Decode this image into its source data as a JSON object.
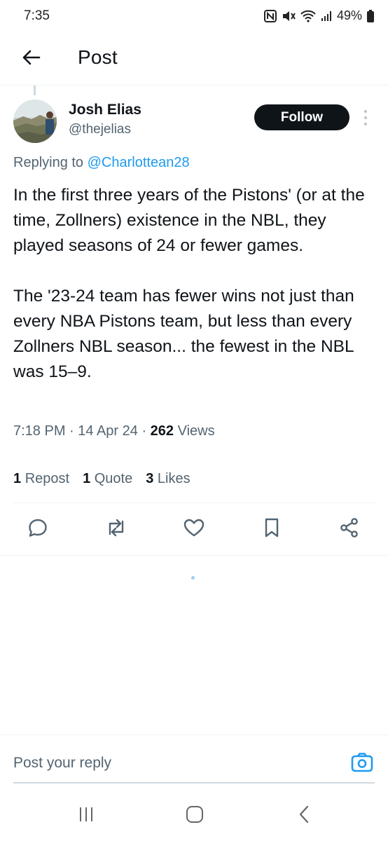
{
  "status_bar": {
    "time": "7:35",
    "battery": "49%",
    "icons": [
      "nfc-icon",
      "mute-icon",
      "wifi-icon",
      "signal-icon",
      "battery-icon"
    ]
  },
  "header": {
    "title": "Post",
    "back_icon": "arrow-left-icon"
  },
  "post": {
    "author": {
      "display_name": "Josh Elias",
      "handle": "@thejelias"
    },
    "follow_label": "Follow",
    "replying_prefix": "Replying to",
    "replying_to": "@Charlottean28",
    "paragraphs": [
      "In the first three years of the Pistons' (or at the time, Zollners) existence in the NBL, they played seasons of 24 or fewer games.",
      "The '23-24 team has fewer wins not just than every NBA Pistons team, but less than every Zollners NBL season... the fewest in the NBL was 15–9."
    ],
    "time": "7:18 PM",
    "date": "14 Apr 24",
    "views_count": "262",
    "views_label": "Views",
    "stats": {
      "reposts_count": "1",
      "reposts_label": "Repost",
      "quotes_count": "1",
      "quotes_label": "Quote",
      "likes_count": "3",
      "likes_label": "Likes"
    },
    "actions": [
      "reply-icon",
      "repost-icon",
      "like-icon",
      "bookmark-icon",
      "share-icon"
    ]
  },
  "reply_bar": {
    "placeholder": "Post your reply",
    "camera_icon": "camera-icon"
  },
  "colors": {
    "accent": "#1d9bf0",
    "text_primary": "#0f1419",
    "text_secondary": "#536471",
    "button_dark": "#0f1419"
  }
}
